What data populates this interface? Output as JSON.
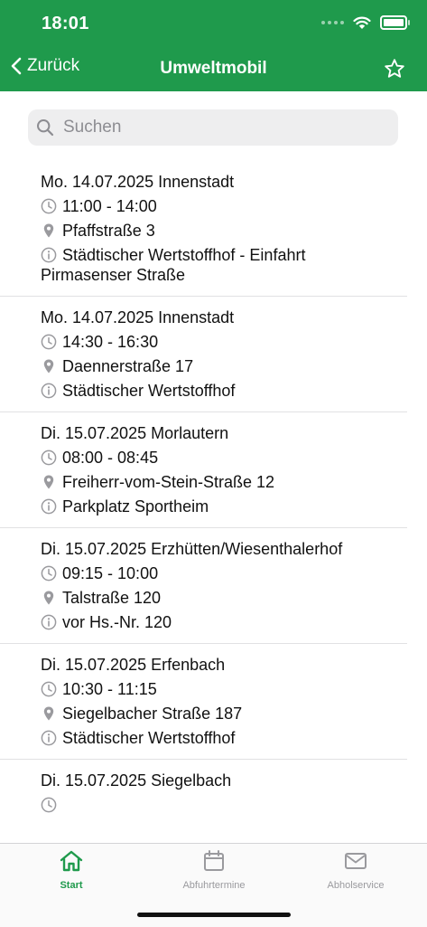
{
  "status_bar": {
    "time": "18:01"
  },
  "nav": {
    "back_label": "Zurück",
    "title": "Umweltmobil"
  },
  "search": {
    "placeholder": "Suchen"
  },
  "colors": {
    "brand_green": "#1f9a4c",
    "icon_gray": "#9a9a9e"
  },
  "entries": [
    {
      "title": "Mo. 14.07.2025 Innenstadt",
      "time": "11:00 - 14:00",
      "address": "Pfaffstraße 3",
      "info": "Städtischer Wertstoffhof - Einfahrt Pirmasenser Straße"
    },
    {
      "title": "Mo. 14.07.2025 Innenstadt",
      "time": "14:30 - 16:30",
      "address": "Daennerstraße 17",
      "info": "Städtischer Wertstoffhof"
    },
    {
      "title": "Di. 15.07.2025 Morlautern",
      "time": "08:00 - 08:45",
      "address": "Freiherr-vom-Stein-Straße 12",
      "info": "Parkplatz Sportheim"
    },
    {
      "title": "Di. 15.07.2025 Erzhütten/Wiesenthalerhof",
      "time": "09:15 - 10:00",
      "address": "Talstraße 120",
      "info": "vor Hs.-Nr. 120"
    },
    {
      "title": "Di. 15.07.2025 Erfenbach",
      "time": "10:30 - 11:15",
      "address": "Siegelbacher Straße 187",
      "info": "Städtischer Wertstoffhof"
    },
    {
      "title": "Di. 15.07.2025 Siegelbach",
      "time": "",
      "address": "",
      "info": ""
    }
  ],
  "tabs": [
    {
      "label": "Start",
      "icon": "home-icon",
      "active": true
    },
    {
      "label": "Abfuhrtermine",
      "icon": "calendar-icon",
      "active": false
    },
    {
      "label": "Abholservice",
      "icon": "mail-icon",
      "active": false
    }
  ]
}
